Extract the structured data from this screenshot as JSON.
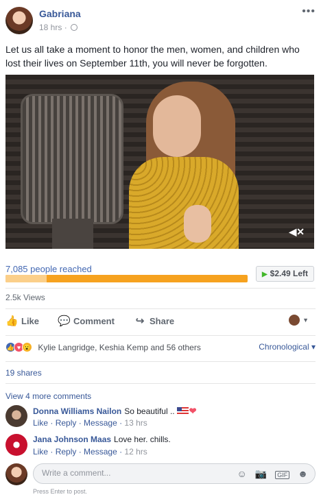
{
  "post": {
    "author": "Gabriana",
    "time": "18 hrs",
    "separator": "·",
    "text": "Let us all take a moment to honor the men, women, and children who lost their lives on September 11th, you will never be forgotten."
  },
  "video": {
    "muted": true
  },
  "promotion": {
    "reach": "7,085 people reached",
    "budget_spent_fraction": 0.17,
    "boost_label": "$2.49 Left",
    "colors": {
      "bar": "#f6a21f",
      "bar_light": "#fbcf8a",
      "play": "#42b72a"
    }
  },
  "stats": {
    "views": "2.5k Views"
  },
  "actions": {
    "like": "Like",
    "comment": "Comment",
    "share": "Share"
  },
  "reactions": {
    "types": [
      "like",
      "love",
      "wow"
    ],
    "names": "Kylie Langridge, Keshia Kemp and 56 others",
    "sort": "Chronological"
  },
  "shares": "19 shares",
  "comments_header": "View 4 more comments",
  "comments": [
    {
      "name": "Donna Williams Nailon",
      "text": "So beautiful ..",
      "like": "Like",
      "reply": "Reply",
      "message": "Message",
      "time": "13 hrs"
    },
    {
      "name": "Jana Johnson Maas",
      "text": "Love her. chills.",
      "like": "Like",
      "reply": "Reply",
      "message": "Message",
      "time": "12 hrs"
    }
  ],
  "composer": {
    "placeholder": "Write a comment...",
    "hint": "Press Enter to post.",
    "gif": "GIF"
  },
  "icons": [
    "globe-icon",
    "more-options-icon",
    "mute-icon",
    "play-icon",
    "like-icon",
    "comment-icon",
    "share-icon",
    "emoji-icon",
    "camera-icon",
    "gif-icon",
    "sticker-icon"
  ]
}
